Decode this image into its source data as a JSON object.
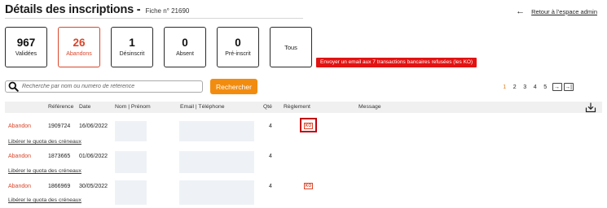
{
  "header": {
    "title": "Détails des inscriptions -",
    "fiche": "Fiche n° 21690",
    "back_link": "Retour à l’espace admin"
  },
  "stats": [
    {
      "num": "967",
      "label": "Validées"
    },
    {
      "num": "26",
      "label": "Abandons"
    },
    {
      "num": "1",
      "label": "Désinscrit"
    },
    {
      "num": "0",
      "label": "Absent"
    },
    {
      "num": "0",
      "label": "Pré-inscrit"
    },
    {
      "num": "",
      "label": "Tous"
    }
  ],
  "email_button": "Envoyer un email aux 7 transactions bancaires refusées (les KO)",
  "search": {
    "placeholder": "Recherche par nom ou numéro de référence",
    "button": "Rechercher"
  },
  "pagination": {
    "pages": [
      "1",
      "2",
      "3",
      "4",
      "5"
    ],
    "current": "1"
  },
  "table": {
    "columns": [
      "Référence",
      "Date",
      "Nom | Prénom",
      "Email | Téléphone",
      "Qté",
      "Règlement",
      "Message"
    ],
    "rows": [
      {
        "status": "Abandon",
        "reference": "1909724",
        "date": "16/06/2022",
        "qty": "4",
        "reglement": "KO",
        "action": "Libérer le quota des créneaux"
      },
      {
        "status": "Abandon",
        "reference": "1873665",
        "date": "01/06/2022",
        "qty": "4",
        "reglement": "",
        "action": "Libérer le quota des créneaux"
      },
      {
        "status": "Abandon",
        "reference": "1866969",
        "date": "30/05/2022",
        "qty": "4",
        "reglement": "KO",
        "action": "Libérer le quota des créneaux"
      }
    ]
  },
  "colors": {
    "accent": "#d9462a",
    "search_button": "#f28c0f",
    "email_button": "#e21313",
    "highlight": "#c2000e"
  }
}
